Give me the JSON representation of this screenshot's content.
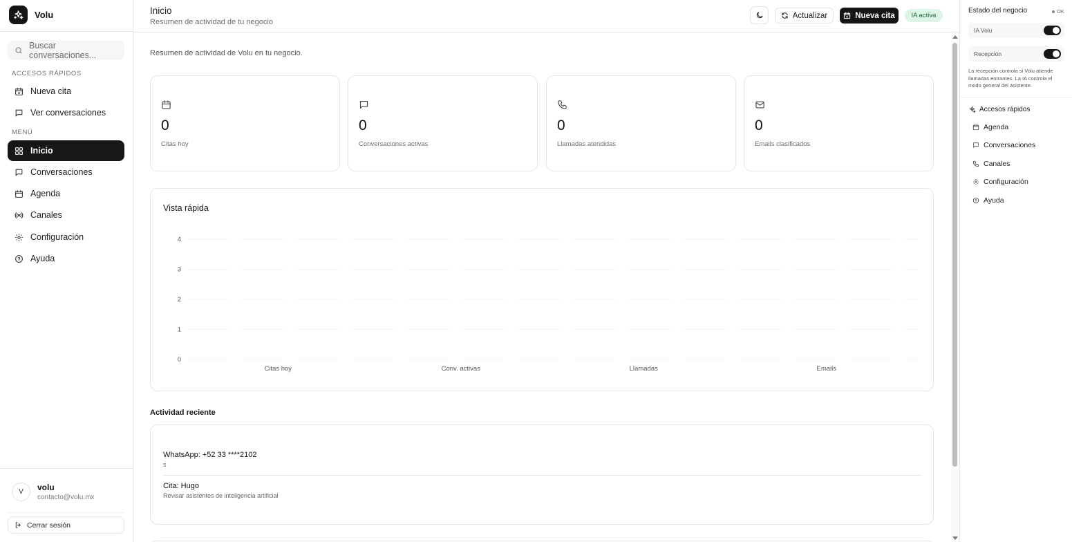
{
  "brand": {
    "name": "Volu"
  },
  "search": {
    "placeholder": "Buscar conversaciones..."
  },
  "sidebar": {
    "quick_access_label": "ACCESOS RÁPIDOS",
    "quick_items": [
      {
        "label": "Nueva cita",
        "icon": "calendar-plus-icon"
      },
      {
        "label": "Ver conversaciones",
        "icon": "message-icon"
      }
    ],
    "menu_label": "MENÚ",
    "menu_items": [
      {
        "label": "Inicio",
        "icon": "grid-icon",
        "active": true
      },
      {
        "label": "Conversaciones",
        "icon": "message-icon"
      },
      {
        "label": "Agenda",
        "icon": "calendar-icon"
      },
      {
        "label": "Canales",
        "icon": "broadcast-icon"
      },
      {
        "label": "Configuración",
        "icon": "gear-icon"
      },
      {
        "label": "Ayuda",
        "icon": "help-icon"
      }
    ]
  },
  "user": {
    "initial": "V",
    "name": "volu",
    "email": "contacto@volu.mx",
    "logout_label": "Cerrar sesión"
  },
  "header": {
    "title": "Inicio",
    "subtitle": "Resumen de actividad de tu negocio",
    "refresh_label": "Actualizar",
    "new_appointment_label": "Nueva cita",
    "ia_badge": "IA activa"
  },
  "main": {
    "description": "Resumen de actividad de Volu en tu negocio.",
    "stats": [
      {
        "value": "0",
        "label": "Citas hoy",
        "icon": "calendar-icon"
      },
      {
        "value": "0",
        "label": "Conversaciones activas",
        "icon": "message-icon"
      },
      {
        "value": "0",
        "label": "Llamadas atendidas",
        "icon": "phone-icon"
      },
      {
        "value": "0",
        "label": "Emails clasificados",
        "icon": "mail-icon"
      }
    ],
    "chart_title": "Vista rápida",
    "recent_title": "Actividad reciente",
    "recent": [
      {
        "title": "WhatsApp: +52 33 ****2102",
        "detail": "s"
      },
      {
        "title": "Cita: Hugo",
        "detail": "Revisar asistentes de inteligencia artificial"
      }
    ]
  },
  "chart_data": {
    "type": "bar",
    "title": "Vista rápida",
    "categories": [
      "Citas hoy",
      "Conv. activas",
      "Llamadas",
      "Emails"
    ],
    "values": [
      0,
      0,
      0,
      0
    ],
    "yticks": [
      "0",
      "1",
      "2",
      "3",
      "4"
    ],
    "ylim": [
      0,
      4
    ],
    "grid": true,
    "xlabel": "",
    "ylabel": ""
  },
  "right_panel": {
    "title": "Estado del negocio",
    "status": "OK",
    "toggles": [
      {
        "label": "IA Volu",
        "on": true
      },
      {
        "label": "Recepción",
        "on": true
      }
    ],
    "note": "La recepción controla si Volu atiende llamadas entrantes. La IA controla el modo general del asistente.",
    "quick_title": "Accesos rápidos",
    "links": [
      {
        "label": "Agenda",
        "icon": "calendar-icon"
      },
      {
        "label": "Conversaciones",
        "icon": "message-icon"
      },
      {
        "label": "Canales",
        "icon": "phone-icon"
      },
      {
        "label": "Configuración",
        "icon": "gear-icon"
      },
      {
        "label": "Ayuda",
        "icon": "help-icon"
      }
    ]
  },
  "colors": {
    "accent_dark": "#151515",
    "badge_bg": "#dcf5e6",
    "badge_text": "#236b3c"
  }
}
